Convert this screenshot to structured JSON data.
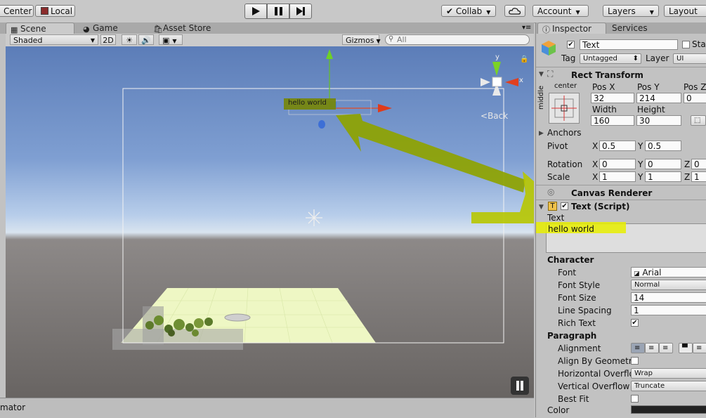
{
  "toolbar": {
    "pivot": "Center",
    "space": "Local",
    "collab": "Collab",
    "account": "Account",
    "layers": "Layers",
    "layout": "Layout"
  },
  "tabs": {
    "scene": "Scene",
    "game": "Game",
    "asset_store": "Asset Store",
    "inspector": "Inspector",
    "services": "Services"
  },
  "scene_bar": {
    "draw_mode": "Shaded",
    "mode_2d": "2D",
    "gizmos": "Gizmos",
    "search_placeholder": "All"
  },
  "scene": {
    "canvas_text": "hello world",
    "gizmo_y": "y",
    "gizmo_x": "x",
    "back_label": "Back"
  },
  "bottom": {
    "animator_tab": "mator"
  },
  "inspector": {
    "object_name": "Text",
    "static_label": "Stat",
    "tag_label": "Tag",
    "tag_value": "Untagged",
    "layer_label": "Layer",
    "layer_value": "UI",
    "rect_transform": {
      "title": "Rect Transform",
      "anchor_h": "center",
      "anchor_v": "middle",
      "pos_x_label": "Pos X",
      "pos_y_label": "Pos Y",
      "pos_z_label": "Pos Z",
      "pos_x": "32",
      "pos_y": "214",
      "pos_z": "0",
      "width_label": "Width",
      "height_label": "Height",
      "width": "160",
      "height": "30",
      "anchors_label": "Anchors",
      "pivot_label": "Pivot",
      "pivot_x": "0.5",
      "pivot_y": "0.5",
      "rotation_label": "Rotation",
      "rot_x": "0",
      "rot_y": "0",
      "rot_z": "0",
      "scale_label": "Scale",
      "scale_x": "1",
      "scale_y": "1",
      "scale_z": "1",
      "x": "X",
      "y": "Y",
      "z": "Z"
    },
    "canvas_renderer": {
      "title": "Canvas Renderer"
    },
    "text_script": {
      "title": "Text (Script)",
      "text_label": "Text",
      "text_value": "hello world",
      "character_header": "Character",
      "font_label": "Font",
      "font_value": "Arial",
      "font_style_label": "Font Style",
      "font_style_value": "Normal",
      "font_size_label": "Font Size",
      "font_size_value": "14",
      "line_spacing_label": "Line Spacing",
      "line_spacing_value": "1",
      "rich_text_label": "Rich Text",
      "paragraph_header": "Paragraph",
      "alignment_label": "Alignment",
      "align_by_geometry_label": "Align By Geometr",
      "horizontal_overflow_label": "Horizontal Overflo",
      "horizontal_overflow_value": "Wrap",
      "vertical_overflow_label": "Vertical Overflow",
      "vertical_overflow_value": "Truncate",
      "best_fit_label": "Best Fit",
      "color_label": "Color"
    }
  },
  "colors": {
    "highlight": "#e8ef00",
    "arrow_annotation": "#8ea300",
    "gizmo_y": "#7bd226",
    "gizmo_x": "#e0401f",
    "gizmo_z": "#3d6fd6"
  }
}
